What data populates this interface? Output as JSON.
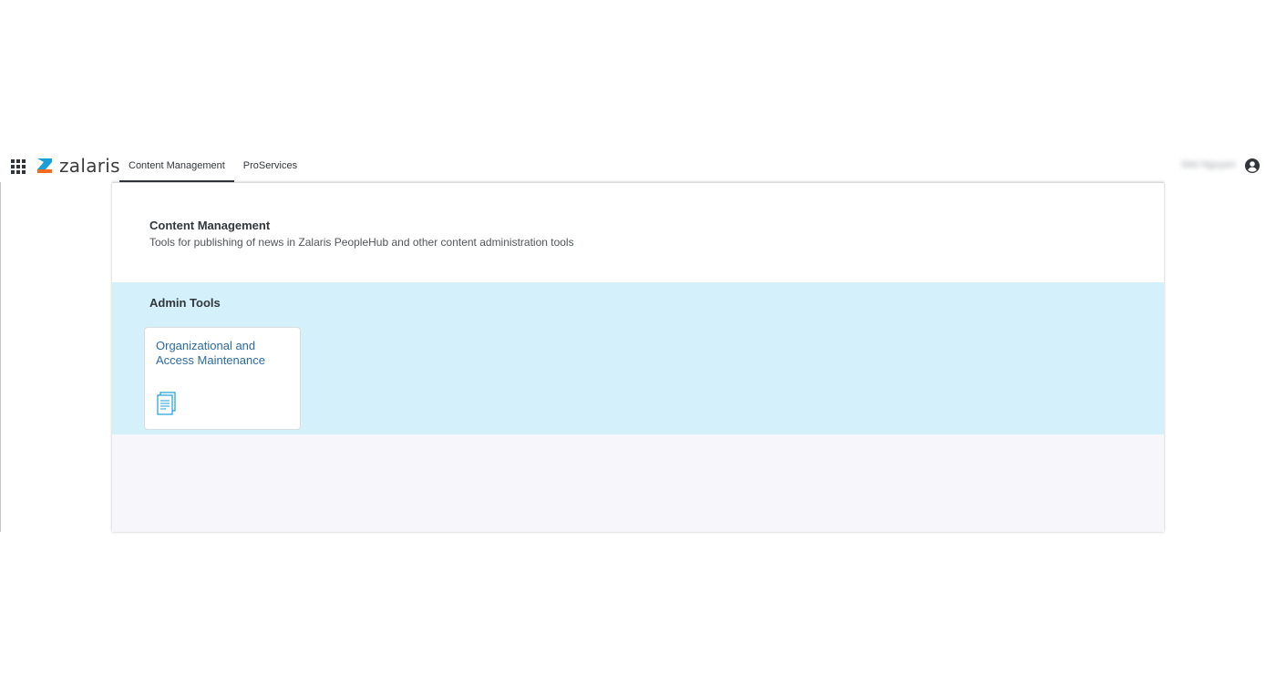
{
  "header": {
    "brand": "zalaris",
    "tabs": [
      {
        "label": "Content Management",
        "active": true
      },
      {
        "label": "ProServices",
        "active": false
      }
    ],
    "user_name": "Wei Nguyen"
  },
  "page": {
    "title": "Content Management",
    "subtitle": "Tools for publishing of news in Zalaris PeopleHub and other content administration tools"
  },
  "section": {
    "title": "Admin Tools",
    "tiles": [
      {
        "title": "Organizational and Access Maintenance",
        "icon": "document-icon"
      }
    ]
  },
  "colors": {
    "accent_blue": "#1a9fd9",
    "brand_orange": "#f26b21",
    "section_bg": "#d3f0fb",
    "tile_title": "#2c6aa0"
  }
}
